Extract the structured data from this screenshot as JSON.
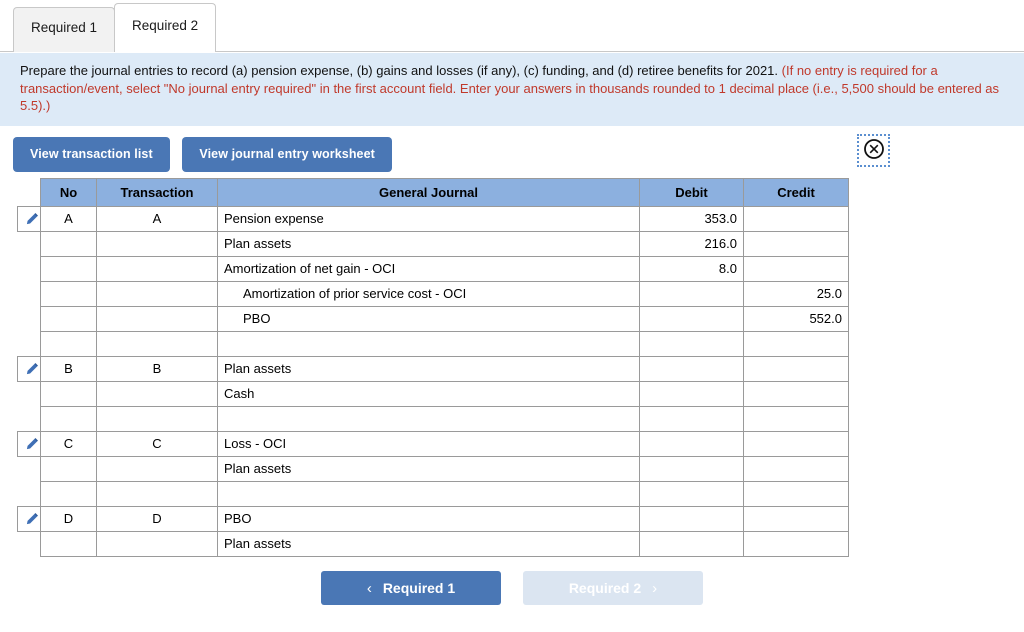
{
  "tabs": [
    {
      "label": "Required 1",
      "active": false
    },
    {
      "label": "Required 2",
      "active": true
    }
  ],
  "instructions": {
    "black_text": "Prepare the journal entries to record (a) pension expense, (b) gains and losses (if any), (c) funding, and (d) retiree benefits for 2021.",
    "red_text": "(If no entry is required for a transaction/event, select \"No journal entry required\" in the first account field. Enter your answers in thousands rounded to 1 decimal place (i.e., 5,500 should be entered as 5.5).)"
  },
  "toolbar": {
    "view_transaction_list_label": "View transaction list",
    "view_journal_entry_worksheet_label": "View journal entry worksheet",
    "close_icon": "circle-x-icon"
  },
  "table": {
    "headers": [
      "No",
      "Transaction",
      "General Journal",
      "Debit",
      "Credit"
    ],
    "rows": [
      {
        "pencil": true,
        "no": "A",
        "transaction": "A",
        "account": "Pension expense",
        "indent": false,
        "debit": "353.0",
        "credit": ""
      },
      {
        "pencil": false,
        "no": "",
        "transaction": "",
        "account": "Plan assets",
        "indent": false,
        "debit": "216.0",
        "credit": ""
      },
      {
        "pencil": false,
        "no": "",
        "transaction": "",
        "account": "Amortization of net gain - OCI",
        "indent": false,
        "debit": "8.0",
        "credit": ""
      },
      {
        "pencil": false,
        "no": "",
        "transaction": "",
        "account": "Amortization of prior service cost - OCI",
        "indent": true,
        "debit": "",
        "credit": "25.0"
      },
      {
        "pencil": false,
        "no": "",
        "transaction": "",
        "account": "PBO",
        "indent": true,
        "debit": "",
        "credit": "552.0"
      },
      {
        "pencil": false,
        "no": "",
        "transaction": "",
        "account": "",
        "indent": false,
        "debit": "",
        "credit": "",
        "spacer": true
      },
      {
        "pencil": true,
        "no": "B",
        "transaction": "B",
        "account": "Plan assets",
        "indent": false,
        "debit": "",
        "credit": ""
      },
      {
        "pencil": false,
        "no": "",
        "transaction": "",
        "account": "Cash",
        "indent": false,
        "debit": "",
        "credit": ""
      },
      {
        "pencil": false,
        "no": "",
        "transaction": "",
        "account": "",
        "indent": false,
        "debit": "",
        "credit": "",
        "spacer": true
      },
      {
        "pencil": true,
        "no": "C",
        "transaction": "C",
        "account": "Loss - OCI",
        "indent": false,
        "debit": "",
        "credit": ""
      },
      {
        "pencil": false,
        "no": "",
        "transaction": "",
        "account": "Plan assets",
        "indent": false,
        "debit": "",
        "credit": ""
      },
      {
        "pencil": false,
        "no": "",
        "transaction": "",
        "account": "",
        "indent": false,
        "debit": "",
        "credit": "",
        "spacer": true
      },
      {
        "pencil": true,
        "no": "D",
        "transaction": "D",
        "account": "PBO",
        "indent": false,
        "debit": "",
        "credit": ""
      },
      {
        "pencil": false,
        "no": "",
        "transaction": "",
        "account": "Plan assets",
        "indent": false,
        "debit": "",
        "credit": ""
      }
    ]
  },
  "footer": {
    "prev_label": "Required 1",
    "prev_chevron": "‹",
    "next_label": "Required 2",
    "next_chevron": "›"
  },
  "colors": {
    "accent_blue": "#4a77b5",
    "header_blue": "#8cb0df",
    "banner_blue": "#ddeaf7",
    "instruction_red": "#c0392b",
    "disabled_blue": "#dbe5f1"
  }
}
